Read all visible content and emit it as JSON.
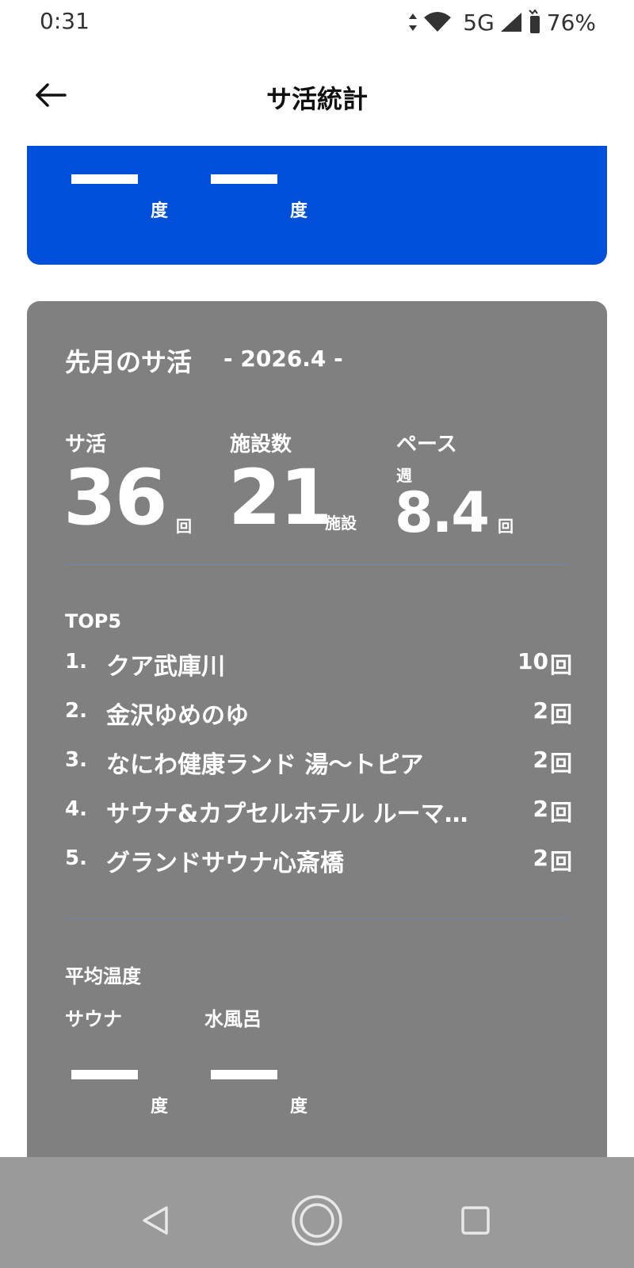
{
  "status": {
    "time": "0:31",
    "network": "5G",
    "battery": "76%",
    "icons": [
      "data-arrows-icon",
      "wifi-icon",
      "signal-icon",
      "battery-icon"
    ]
  },
  "app_bar": {
    "title": "サ活統計",
    "back_icon": "arrow-left-icon"
  },
  "blue_card": {
    "color": "#004fd9",
    "temps": [
      {
        "value": "",
        "unit": "度"
      },
      {
        "value": "",
        "unit": "度"
      }
    ]
  },
  "last_month": {
    "title": "先月のサ活",
    "period": "- 2026.4 -",
    "stats": {
      "visits": {
        "label": "サ活",
        "value": "36",
        "unit": "回"
      },
      "facilities": {
        "label": "施設数",
        "value": "21",
        "unit": "施設"
      },
      "pace": {
        "label": "ペース",
        "prefix": "週",
        "value": "8.4",
        "unit": "回"
      }
    },
    "top5": {
      "label": "TOP5",
      "items": [
        {
          "rank": "1.",
          "name": "クア武庫川",
          "count": "10",
          "unit": "回"
        },
        {
          "rank": "2.",
          "name": "金沢ゆめのゆ",
          "count": "2",
          "unit": "回"
        },
        {
          "rank": "3.",
          "name": "なにわ健康ランド 湯〜トピア",
          "count": "2",
          "unit": "回"
        },
        {
          "rank": "4.",
          "name": "サウナ&カプセルホテル ルーマ…",
          "count": "2",
          "unit": "回"
        },
        {
          "rank": "5.",
          "name": "グランドサウナ心斎橋",
          "count": "2",
          "unit": "回"
        }
      ]
    },
    "avg_temp": {
      "label": "平均温度",
      "sauna": {
        "label": "サウナ",
        "unit": "度"
      },
      "water": {
        "label": "水風呂",
        "unit": "度"
      }
    },
    "card_color": "#808080"
  },
  "nav": {
    "icons": [
      "back-triangle-icon",
      "home-circle-icon",
      "recents-square-icon"
    ]
  }
}
